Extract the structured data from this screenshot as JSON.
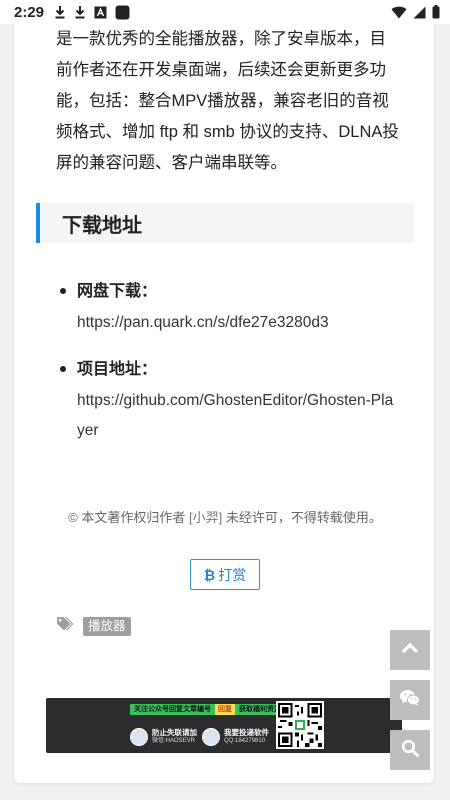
{
  "status_bar": {
    "time": "2:29",
    "notification_icons": [
      "download-icon",
      "download-icon",
      "a-icon",
      "square-icon"
    ],
    "right_icons": [
      "wifi-icon",
      "signal-icon",
      "battery-icon"
    ]
  },
  "article": {
    "intro_text": "是一款优秀的全能播放器，除了安卓版本，目前作者还在开发桌面端，后续还会更新更多功能，包括：整合MPV播放器，兼容老旧的音视频格式、增加 ftp 和 smb 协议的支持、DLNA投屏的兼容问题、客户端串联等。",
    "section_title": "下载地址",
    "download_items": [
      {
        "label": "网盘下载：",
        "url": "https://pan.quark.cn/s/dfe27e3280d3"
      },
      {
        "label": "项目地址：",
        "url": "https://github.com/GhostenEditor/Ghosten-Player"
      }
    ],
    "copyright": {
      "prefix": "© 本文著作权归作者",
      "author": "[小羿]",
      "suffix": "未经许可，不得转载使用。"
    },
    "reward_button": {
      "icon": "bitcoin-icon",
      "label": "打赏"
    },
    "tags": {
      "icon": "tags-icon",
      "items": [
        "播放器"
      ]
    }
  },
  "banner": {
    "top_left": "关注公众号回复文章编号",
    "top_mid": "回复",
    "top_right": "获取福利资源",
    "left_title": "防止失联请加",
    "left_sub": "微信:HAOSEVR",
    "right_title": "我要投递软件",
    "right_sub": "QQ:184279810"
  },
  "float_buttons": [
    "chevron-up-icon",
    "wechat-icon",
    "search-icon"
  ],
  "colors": {
    "accent": "#1e88e5",
    "link_button": "#2b7fd0",
    "float_button_bg": "#bdbdbd",
    "tag_bg": "#9e9e9e",
    "banner_bg": "#2c2c2e"
  }
}
